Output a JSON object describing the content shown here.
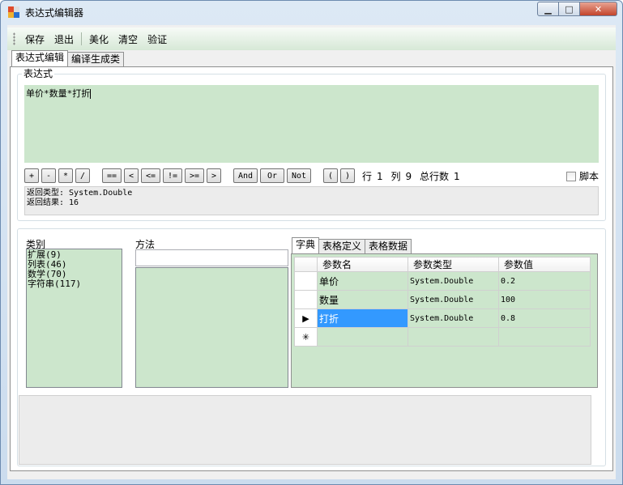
{
  "window": {
    "title": "表达式编辑器",
    "minimize_glyph": "▁",
    "maximize_glyph": "□",
    "close_glyph": "✕"
  },
  "toolbar": {
    "save": "保存",
    "exit": "退出",
    "beautify": "美化",
    "clear": "清空",
    "validate": "验证"
  },
  "tabs": [
    "表达式编辑",
    "编译生成类"
  ],
  "expression": {
    "group_label": "表达式",
    "text": "单价*数量*打折",
    "operators": [
      "+",
      "-",
      "*",
      "/",
      "==",
      "<",
      "<=",
      "!=",
      ">=",
      ">",
      "And",
      "Or",
      "Not",
      "(",
      ")"
    ],
    "row_label": "行",
    "row": "1",
    "col_label": "列",
    "col": "9",
    "total_label": "总行数",
    "total": "1",
    "script_label": "脚本",
    "script_checked": false,
    "return_type_line": "返回类型: System.Double",
    "return_result_line": "返回结果: 16"
  },
  "category": {
    "label": "类别",
    "items": [
      "扩展(9)",
      "列表(46)",
      "数学(70)",
      "字符串(117)"
    ]
  },
  "method": {
    "label": "方法",
    "search_value": ""
  },
  "inner_tabs": [
    "字典",
    "表格定义",
    "表格数据"
  ],
  "grid": {
    "columns": [
      "参数名",
      "参数类型",
      "参数值"
    ],
    "rows": [
      {
        "marker": "",
        "name": "单价",
        "type": "System.Double",
        "value": "0.2"
      },
      {
        "marker": "",
        "name": "数量",
        "type": "System.Double",
        "value": "100"
      },
      {
        "marker": "▶",
        "name": "打折",
        "type": "System.Double",
        "value": "0.8"
      },
      {
        "marker": "✳",
        "name": "",
        "type": "",
        "value": ""
      }
    ]
  },
  "colors": {
    "panel_green": "#cce6cc",
    "selection_blue": "#3399ff"
  }
}
